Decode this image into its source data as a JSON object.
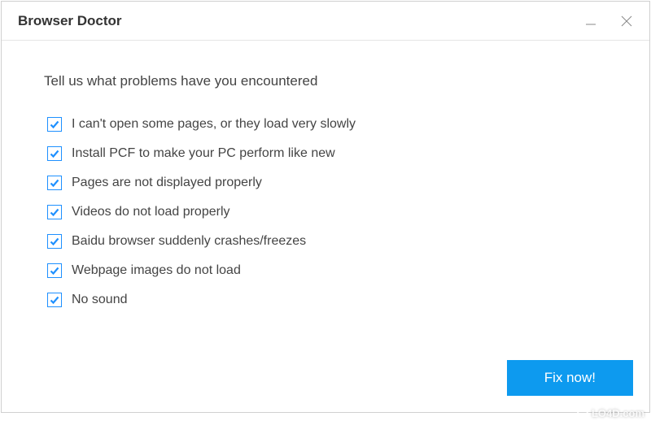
{
  "titlebar": {
    "title": "Browser Doctor"
  },
  "content": {
    "prompt": "Tell us what problems have you encountered",
    "options": [
      {
        "label": "I can't open some pages, or they load very slowly",
        "checked": true
      },
      {
        "label": "Install PCF to make your PC perform like new",
        "checked": true
      },
      {
        "label": "Pages are not displayed properly",
        "checked": true
      },
      {
        "label": "Videos do not load properly",
        "checked": true
      },
      {
        "label": "Baidu browser suddenly crashes/freezes",
        "checked": true
      },
      {
        "label": "Webpage images do not load",
        "checked": true
      },
      {
        "label": "No sound",
        "checked": true
      }
    ],
    "fix_button_label": "Fix now!"
  },
  "watermark": {
    "text": "LO4D.com"
  },
  "colors": {
    "accent": "#1e90ff",
    "button": "#0d9aef"
  }
}
